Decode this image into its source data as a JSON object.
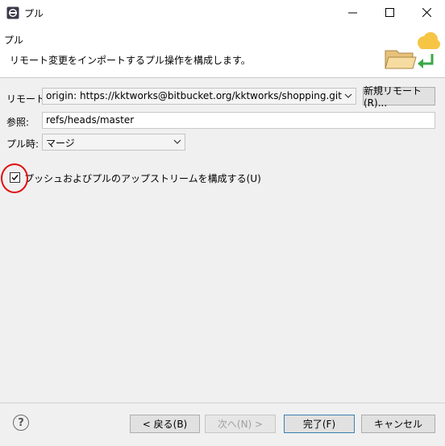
{
  "window": {
    "title": "プル",
    "controls": {
      "minimize": "minimize-icon",
      "maximize": "maximize-icon",
      "close": "close-icon"
    }
  },
  "header": {
    "title": "プル",
    "description": "リモート変更をインポートするプル操作を構成します。",
    "image_icon": "folder-cloud-icon"
  },
  "form": {
    "remote": {
      "label": "リモート:",
      "value": "origin: https://kktworks@bitbucket.org/kktworks/shopping.git",
      "new_remote_button": "新規リモート(R)..."
    },
    "reference": {
      "label": "参照:",
      "value": "refs/heads/master"
    },
    "pull_mode": {
      "label": "プル時:",
      "value": "マージ"
    },
    "configure_upstream": {
      "label": "プッシュおよびプルのアップストリームを構成する(U)",
      "checked": true
    }
  },
  "footer": {
    "help_icon": "help-icon",
    "help_glyph": "?",
    "back": "< 戻る(B)",
    "next": "次へ(N) >",
    "finish": "完了(F)",
    "cancel": "キャンセル"
  },
  "annotation": {
    "color": "#e01010",
    "shape": "circle around checkbox"
  }
}
